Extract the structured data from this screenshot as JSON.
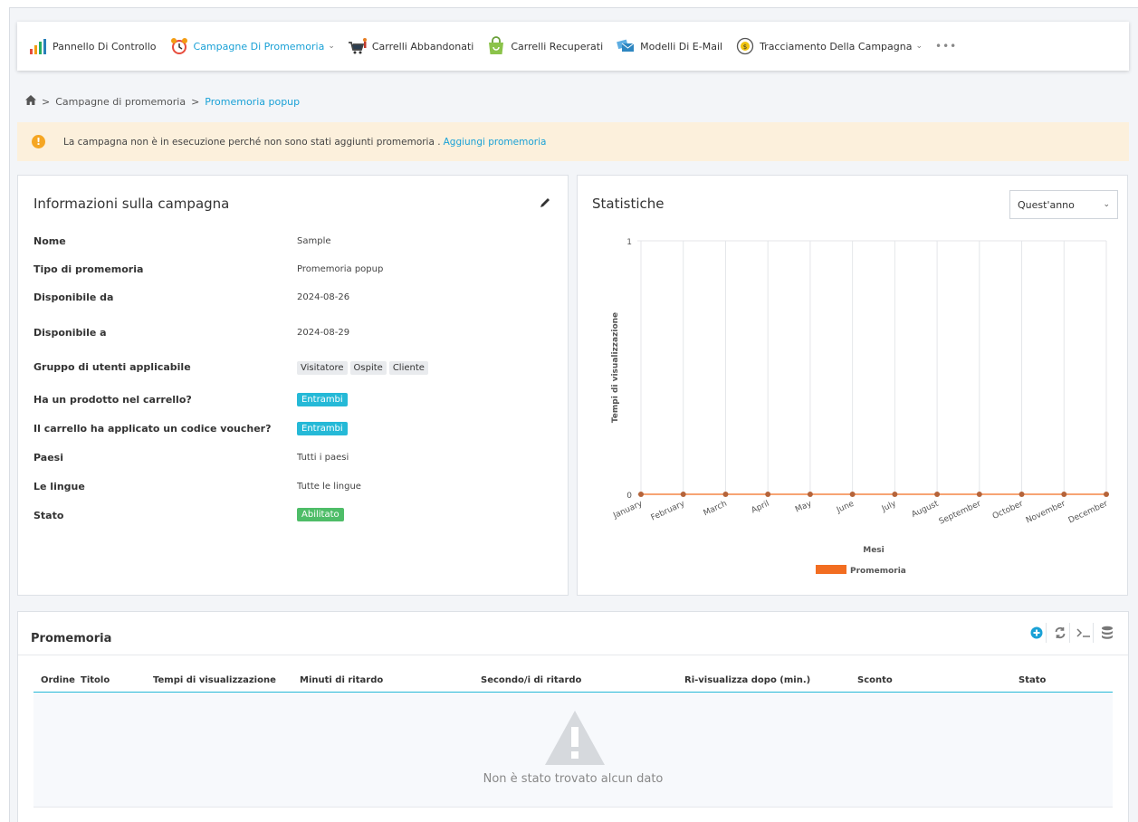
{
  "nav": {
    "items": [
      {
        "label": "Pannello Di Controllo",
        "icon": "bar-chart-icon"
      },
      {
        "label": "Campagne Di Promemoria",
        "icon": "alarm-clock-icon",
        "active": true,
        "dropdown": true
      },
      {
        "label": "Carrelli Abbandonati",
        "icon": "cart-person-icon"
      },
      {
        "label": "Carrelli Recuperati",
        "icon": "shopping-bag-icon"
      },
      {
        "label": "Modelli Di E-Mail",
        "icon": "email-templates-icon"
      },
      {
        "label": "Tracciamento Della Campagna",
        "icon": "tracking-icon",
        "dropdown": true
      }
    ],
    "more": "•••"
  },
  "breadcrumb": {
    "sep": ">",
    "level1": "Campagne di promemoria",
    "current": "Promemoria popup"
  },
  "alert": {
    "text": "La campagna non è in esecuzione perché non sono stati aggiunti promemoria .",
    "link": "Aggiungi promemoria"
  },
  "info": {
    "title": "Informazioni sulla campagna",
    "rows": [
      {
        "label": "Nome",
        "value": "Sample"
      },
      {
        "label": "Tipo di promemoria",
        "value": "Promemoria popup"
      },
      {
        "label": "Disponibile da",
        "value": "2024-08-26"
      },
      {
        "label": "Disponibile a",
        "value": "2024-08-29"
      },
      {
        "label": "Gruppo di utenti applicabile",
        "tags": [
          "Visitatore",
          "Ospite",
          "Cliente"
        ]
      },
      {
        "label": "Ha un prodotto nel carrello?",
        "badge": "Entrambi"
      },
      {
        "label": "Il carrello ha applicato un codice voucher?",
        "badge": "Entrambi"
      },
      {
        "label": "Paesi",
        "value": "Tutti i paesi"
      },
      {
        "label": "Le lingue",
        "value": "Tutte le lingue"
      },
      {
        "label": "Stato",
        "status": "Abilitato"
      }
    ]
  },
  "stats": {
    "title": "Statistiche",
    "period": "Quest'anno"
  },
  "chart_data": {
    "type": "line",
    "categories": [
      "January",
      "February",
      "March",
      "April",
      "May",
      "June",
      "July",
      "August",
      "September",
      "October",
      "November",
      "December"
    ],
    "series": [
      {
        "name": "Promemoria",
        "values": [
          0,
          0,
          0,
          0,
          0,
          0,
          0,
          0,
          0,
          0,
          0,
          0
        ],
        "color": "#f26d21"
      }
    ],
    "ylabel": "Tempi di visualizzazione",
    "xlabel": "Mesi",
    "ylim": [
      0,
      1
    ],
    "yticks": [
      "1",
      "0"
    ],
    "grid": true,
    "legend": "bottom"
  },
  "reminders": {
    "title": "Promemoria",
    "columns": [
      "Ordine",
      "Titolo",
      "Tempi di visualizzazione",
      "Minuti di ritardo",
      "Secondo/i di ritardo",
      "Ri-visualizza dopo (min.)",
      "Sconto",
      "Stato"
    ],
    "empty": "Non è stato trovato alcun dato"
  },
  "colors": {
    "accent": "#1aa1d6",
    "badge": "#25b9d7",
    "success": "#4ebd68",
    "warning": "#f5a623",
    "series": "#f26d21"
  }
}
